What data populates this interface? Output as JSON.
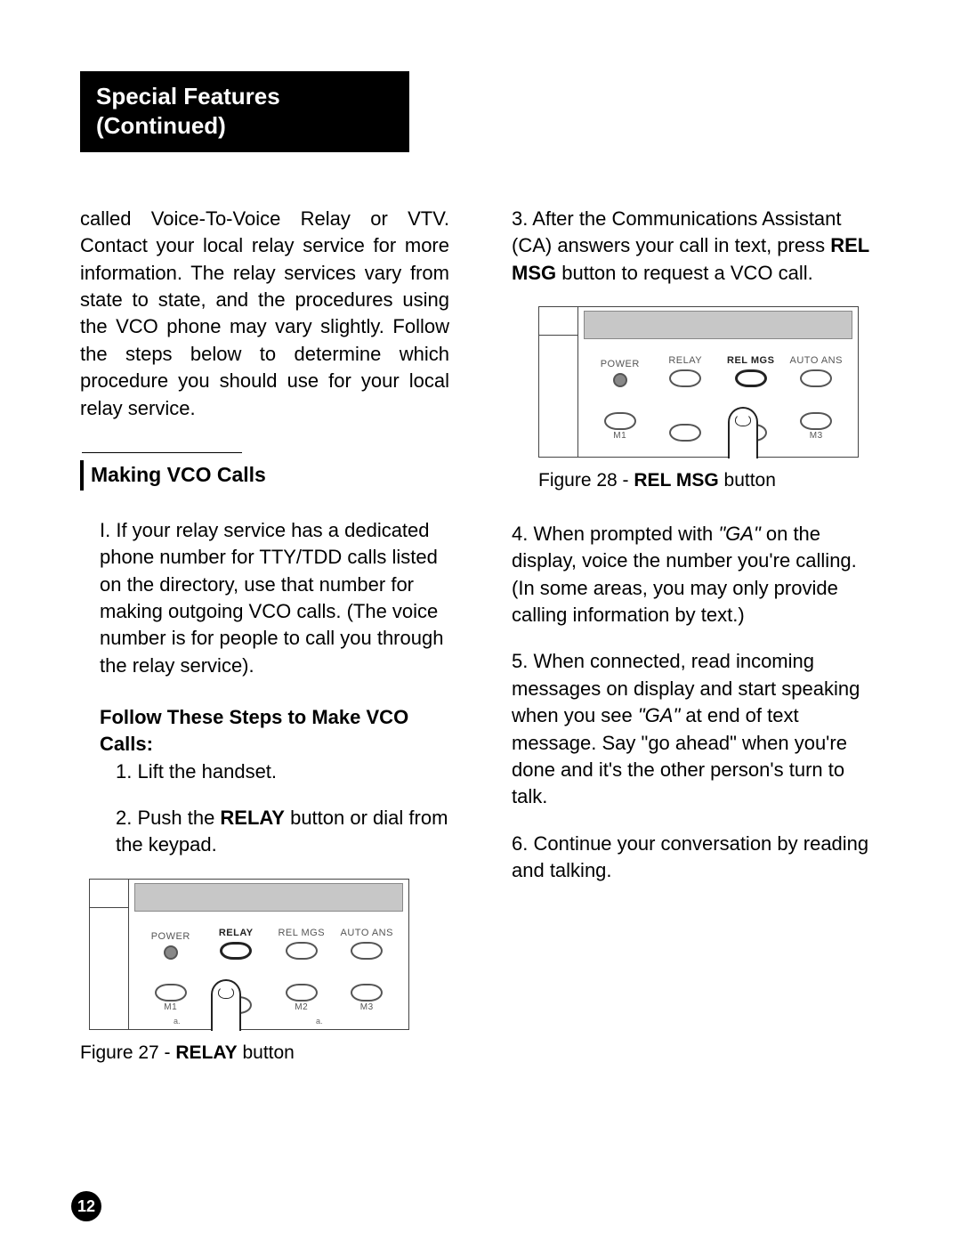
{
  "header": {
    "line1": "Special Features",
    "line2": "(Continued)"
  },
  "intro": "called Voice-To-Voice Relay or VTV. Contact  your local relay service for more information. The relay services vary from state to state, and the procedures using the VCO phone may vary slightly.  Follow the steps below to determine which procedure you should use for your local relay service.",
  "section_title": "Making VCO Calls",
  "roman_intro": "I. If your relay service has a dedicated phone number for TTY/TDD calls listed on the directory, use that number for making outgoing VCO calls. (The voice number is for people to call you through the relay service).",
  "follow_heading": "Follow These Steps to Make VCO Calls:",
  "step1": "Lift the handset.",
  "step2_pre": "Push the ",
  "step2_bold": "RELAY",
  "step2_post": " button or dial from the keypad.",
  "fig27_pre": "Figure 27 - ",
  "fig27_bold": "RELAY",
  "fig27_post": " button",
  "step3_pre": "After the Communications Assistant (CA) answers your call in text, press ",
  "step3_bold": "REL MSG",
  "step3_post": " button to request a VCO call.",
  "fig28_pre": "Figure 28 - ",
  "fig28_bold": "REL MSG",
  "fig28_post": " button",
  "step4_pre": "When prompted with ",
  "step4_ital": "\"GA\"",
  "step4_post": " on the display, voice the number you're calling. (In some areas, you may only provide calling information by text.)",
  "step5_pre": "When connected, read incoming messages on display and start speaking when you see ",
  "step5_ital": "\"GA\"",
  "step5_post": "  at end of text message. Say \"go ahead\" when you're done and it's the other person's turn to talk.",
  "step6": "Continue your conversation by reading and talking.",
  "device_labels": {
    "power": "POWER",
    "relay": "RELAY",
    "relmgs": "REL MGS",
    "autoans": "AUTO ANS",
    "m1": "M1",
    "m2": "M2",
    "m3": "M3",
    "a": "a."
  },
  "page_number": "12",
  "nums": {
    "n1": "1. ",
    "n2": "2. ",
    "n3": "3. ",
    "n4": "4. ",
    "n5": "5. ",
    "n6": "6. "
  }
}
